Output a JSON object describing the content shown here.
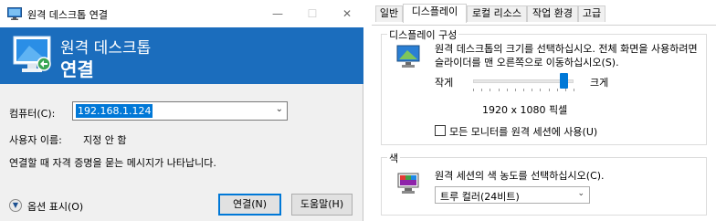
{
  "left_window": {
    "title": "원격 데스크톱 연결",
    "controls": {
      "minimize": "—",
      "maximize": "☐",
      "close": "✕"
    },
    "banner": {
      "line1": "원격 데스크톱",
      "line2": "연결"
    },
    "computer_label": "컴퓨터(C):",
    "computer_value": "192.168.1.124",
    "user_label": "사용자 이름:",
    "user_value": "지정 안 함",
    "credentials_note": "연결할 때 자격 증명을 묻는 메시지가 나타납니다.",
    "options_label": "옵션 표시(O)",
    "connect_button": "연결(N)",
    "help_button": "도움말(H)"
  },
  "right_panel": {
    "tabs": [
      "일반",
      "디스플레이",
      "로컬 리소스",
      "작업 환경",
      "고급"
    ],
    "active_tab": "디스플레이",
    "display_group": {
      "title": "디스플레이 구성",
      "description": "원격 데스크톱의 크기를 선택하십시오. 전체 화면을 사용하려면 슬라이더를 맨 오른쪽으로 이동하십시오(S).",
      "slider_small_label": "작게",
      "slider_large_label": "크게",
      "slider_position": 0.9,
      "resolution": "1920 x 1080 픽셀",
      "all_monitors_label": "모든 모니터를 원격 세션에 사용(U)",
      "all_monitors_checked": false
    },
    "color_group": {
      "title": "색",
      "description": "원격 세션의 색 농도를 선택하십시오(C).",
      "selected": "트루 컬러(24비트)"
    }
  },
  "colors": {
    "accent": "#0078d7",
    "banner": "#1b6dbd"
  }
}
